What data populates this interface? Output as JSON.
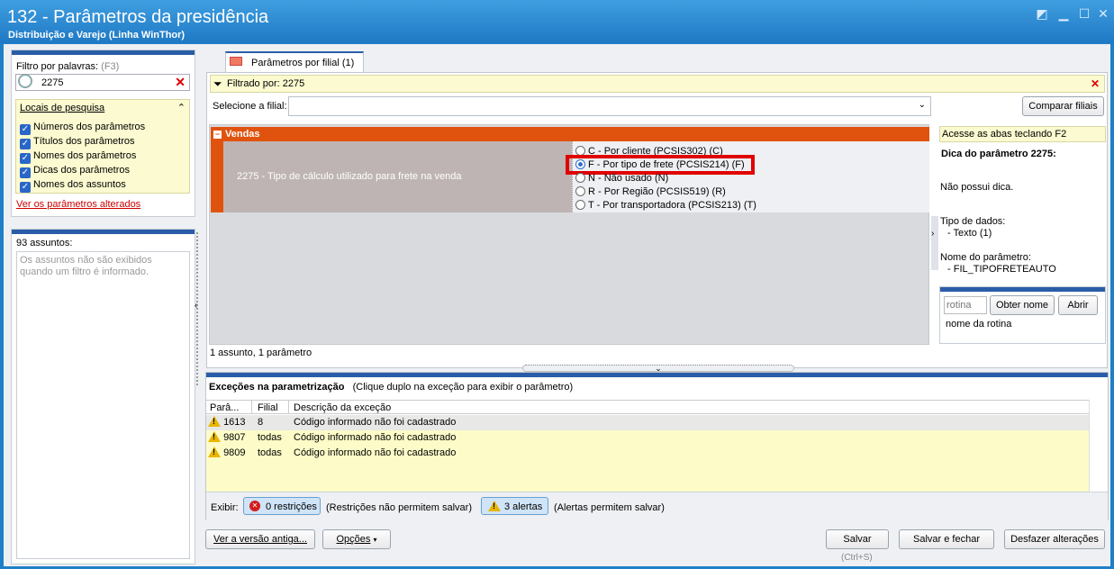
{
  "window": {
    "title": "132 - Parâmetros da presidência",
    "subtitle": "Distribuição e Varejo (Linha WinThor)"
  },
  "filter": {
    "label": "Filtro por palavras:",
    "shortcut": "(F3)",
    "value": "2275",
    "locais_title": "Locais de pesquisa",
    "options": [
      "Números dos parâmetros",
      "Títulos dos parâmetros",
      "Nomes dos parâmetros",
      "Dicas dos parâmetros",
      "Nomes dos assuntos"
    ],
    "changed_link": "Ver os parâmetros alterados"
  },
  "subjects": {
    "count_label": "93 assuntos:",
    "hint": "Os assuntos não são exibidos quando um filtro é informado."
  },
  "tab": {
    "label": "Parâmetros por filial",
    "count": "(1)"
  },
  "filtered": {
    "label": "Filtrado por: 2275"
  },
  "filial": {
    "label": "Selecione a filial:",
    "compare": "Comparar filiais"
  },
  "group": {
    "title": "Vendas",
    "param_desc": "2275 - Tipo de cálculo utilizado para frete na venda",
    "options": [
      "C - Por cliente (PCSIS302) (C)",
      "F - Por tipo de frete (PCSIS214) (F)",
      "N - Não usado (N)",
      "R - Por Região (PCSIS519) (R)",
      "T - Por transportadora (PCSIS213) (T)"
    ],
    "selected": 1
  },
  "status": "1 assunto, 1 parâmetro",
  "tip": {
    "access": "Acesse as abas teclando F2",
    "title": "Dica do parâmetro 2275:",
    "body": "Não possui dica.",
    "type_label": "Tipo de dados:",
    "type_value": "- Texto (1)",
    "name_label": "Nome do parâmetro:",
    "name_value": "- FIL_TIPOFRETEAUTO"
  },
  "routine": {
    "placeholder": "rotina",
    "get_name": "Obter nome",
    "open": "Abrir",
    "name_label": "nome da rotina"
  },
  "exceptions": {
    "title": "Exceções na parametrização",
    "hint": "(Clique duplo na exceção para exibir o parâmetro)",
    "columns": [
      "Parâ...",
      "Filial",
      "Descrição da exceção"
    ],
    "rows": [
      {
        "param": "1613",
        "filial": "8",
        "desc": "Código informado não foi cadastrado"
      },
      {
        "param": "9807",
        "filial": "todas",
        "desc": "Código informado não foi cadastrado"
      },
      {
        "param": "9809",
        "filial": "todas",
        "desc": "Código informado não foi cadastrado"
      }
    ],
    "show_label": "Exibir:",
    "restrictions": "0 restrições",
    "restrictions_note": "(Restrições não permitem salvar)",
    "alerts": "3 alertas",
    "alerts_note": "(Alertas permitem salvar)"
  },
  "footer": {
    "old_version": "Ver a versão antiga...",
    "options": "Opções",
    "save": "Salvar",
    "save_shortcut": "(Ctrl+S)",
    "save_close": "Salvar e fechar",
    "undo": "Desfazer alterações"
  }
}
